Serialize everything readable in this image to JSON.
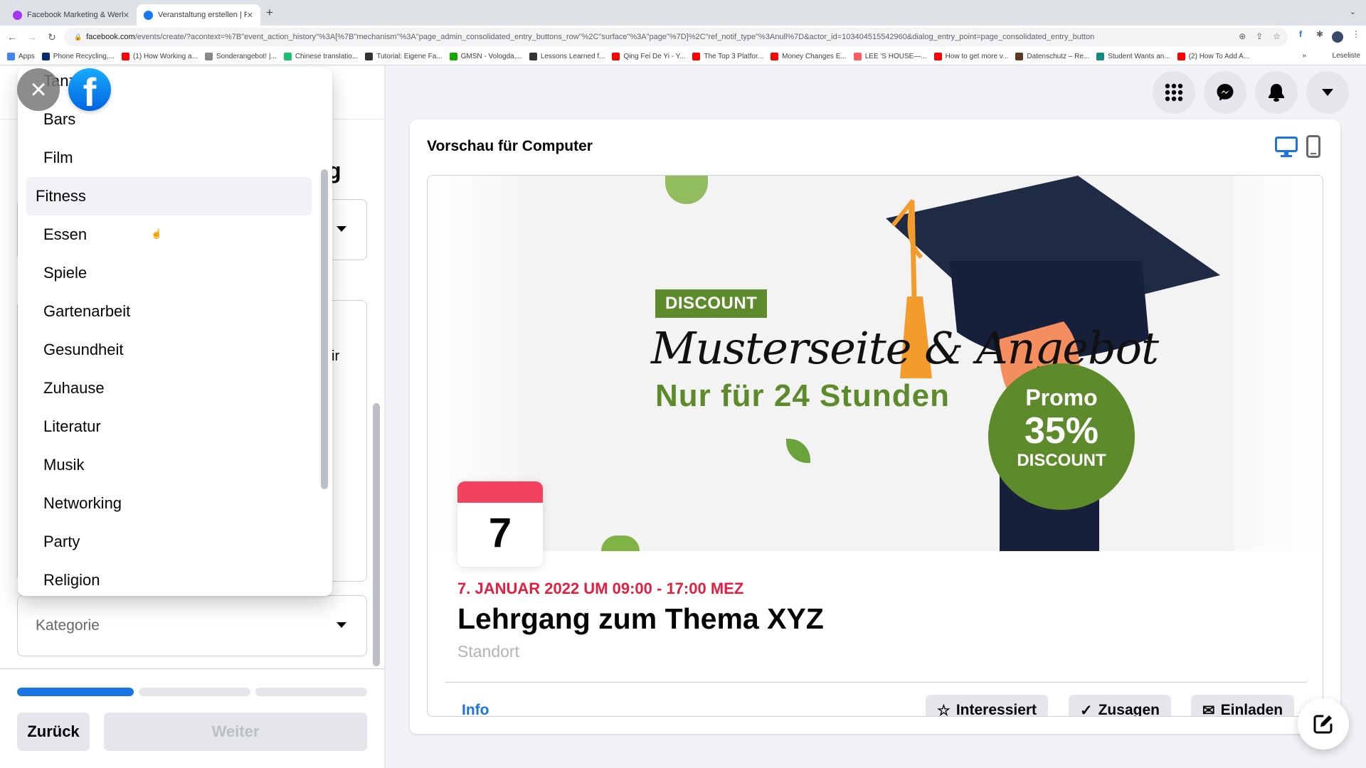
{
  "browser": {
    "tabs": [
      {
        "title": "Facebook Marketing & Werbea",
        "favicon": "udemy-icon",
        "active": false
      },
      {
        "title": "Veranstaltung erstellen | Faceb",
        "favicon": "facebook-icon",
        "active": true
      }
    ],
    "url_host": "facebook.com",
    "url_path": "/events/create/?acontext=%7B\"event_action_history\"%3A[%7B\"mechanism\"%3A\"page_admin_consolidated_entry_buttons_row\"%2C\"surface\"%3A\"page\"%7D]%2C\"ref_notif_type\"%3Anull%7D&actor_id=103404515542960&dialog_entry_point=page_consolidated_entry_button",
    "bookmarks": [
      {
        "label": "Apps",
        "icon": "apps-grid-icon"
      },
      {
        "label": "Phone Recycling,...",
        "icon": "o2-icon"
      },
      {
        "label": "(1) How Working a...",
        "icon": "youtube-icon"
      },
      {
        "label": "Sonderangebot! |...",
        "icon": "badge-icon"
      },
      {
        "label": "Chinese translatio...",
        "icon": "fiverr-icon"
      },
      {
        "label": "Tutorial: Eigene Fa...",
        "icon": "hash-icon"
      },
      {
        "label": "GMSN - Vologda,...",
        "icon": "upwork-icon"
      },
      {
        "label": "Lessons Learned f...",
        "icon": "percent-icon"
      },
      {
        "label": "Qing Fei De Yi - Y...",
        "icon": "youtube-icon"
      },
      {
        "label": "The Top 3 Platfor...",
        "icon": "youtube-icon"
      },
      {
        "label": "Money Changes E...",
        "icon": "youtube-icon"
      },
      {
        "label": "LEE 'S HOUSE—...",
        "icon": "airbnb-icon"
      },
      {
        "label": "How to get more v...",
        "icon": "youtube-icon"
      },
      {
        "label": "Datenschutz – Re...",
        "icon": "site-icon"
      },
      {
        "label": "Student Wants an...",
        "icon": "t-icon"
      },
      {
        "label": "(2) How To Add A...",
        "icon": "youtube-icon"
      }
    ],
    "reading_list": "Leseliste"
  },
  "dropdown": {
    "partial_top_item": "Tanz",
    "items": [
      "Bars",
      "Film",
      "Fitness",
      "Essen",
      "Spiele",
      "Gartenarbeit",
      "Gesundheit",
      "Zuhause",
      "Literatur",
      "Musik",
      "Networking",
      "Party",
      "Religion"
    ],
    "hovered": "Fitness"
  },
  "form": {
    "category_placeholder": "Kategorie",
    "progress": {
      "steps": 3,
      "current": 1
    },
    "back_label": "Zurück",
    "next_label": "Weiter",
    "background_fragments": [
      "g",
      "ir"
    ]
  },
  "preview": {
    "title": "Vorschau für Computer",
    "banner": {
      "tag": "DISCOUNT",
      "headline": "Musterseite & Angebot",
      "subline": "Nur für 24 Stunden",
      "promo_line1": "Promo",
      "promo_line2": "35%",
      "promo_line3": "DISCOUNT"
    },
    "calendar_day": "7",
    "date": "7. JANUAR 2022 UM 09:00 - 17:00 MEZ",
    "event_title": "Lehrgang zum Thema XYZ",
    "location_placeholder": "Standort",
    "info_tab": "Info",
    "buttons": {
      "interested": "Interessiert",
      "going": "Zusagen",
      "invite": "Einladen"
    }
  },
  "colors": {
    "accent": "#1b74e4",
    "date_red": "#e41e3f",
    "promo_green": "#5d8b2b"
  }
}
